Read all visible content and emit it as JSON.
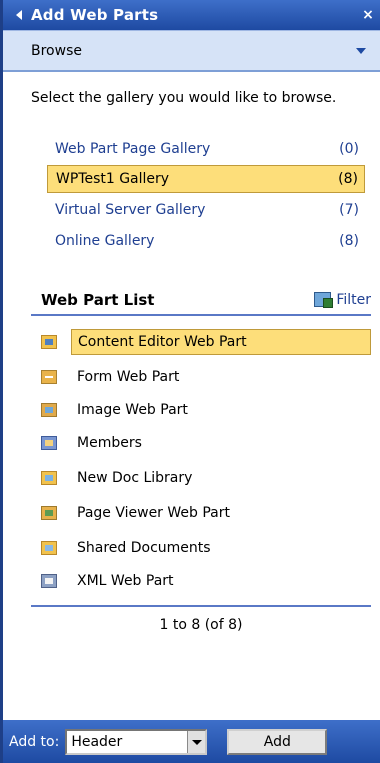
{
  "panel": {
    "title": "Add Web Parts",
    "close_symbol": "×",
    "mode_label": "Browse"
  },
  "intro_text": "Select the gallery you would like to browse.",
  "galleries": [
    {
      "name": "Web Part Page Gallery",
      "count": "(0)"
    },
    {
      "name": "WPTest1 Gallery",
      "count": "(8)"
    },
    {
      "name": "Virtual Server Gallery",
      "count": "(7)"
    },
    {
      "name": "Online Gallery",
      "count": "(8)"
    }
  ],
  "web_part_list": {
    "title": "Web Part List",
    "filter_label": "Filter",
    "items": [
      {
        "label": "Content Editor Web Part",
        "icon": "content-editor-icon"
      },
      {
        "label": "Form Web Part",
        "icon": "form-icon"
      },
      {
        "label": "Image Web Part",
        "icon": "image-icon"
      },
      {
        "label": "Members",
        "icon": "members-icon"
      },
      {
        "label": "New Doc Library",
        "icon": "doc-library-icon"
      },
      {
        "label": "Page Viewer Web Part",
        "icon": "page-viewer-icon"
      },
      {
        "label": "Shared Documents",
        "icon": "shared-documents-icon"
      },
      {
        "label": "XML Web Part",
        "icon": "xml-icon"
      }
    ],
    "range_text": "1 to 8 (of 8)"
  },
  "footer": {
    "add_to_label": "Add to:",
    "zone_value": "Header",
    "add_button_label": "Add"
  },
  "colors": {
    "title_bar": "#1e4aa2",
    "selection": "#fdde7a",
    "link": "#1f3f91"
  }
}
